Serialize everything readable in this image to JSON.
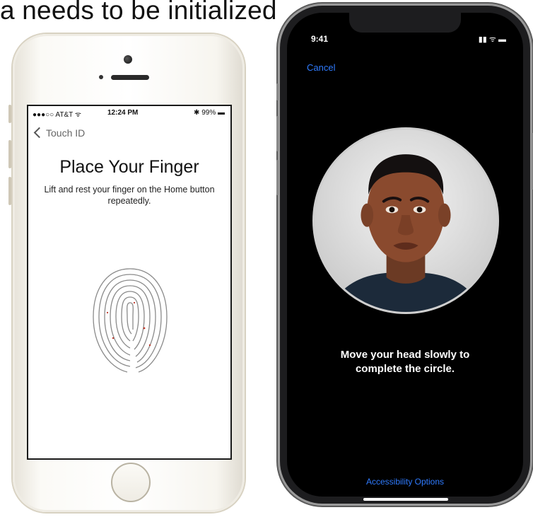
{
  "caption": "a needs to be initialized",
  "touch_id_phone": {
    "status": {
      "carrier": "●●●○○ AT&T ᯤ",
      "time": "12:24 PM",
      "battery": "✱ 99% ▬"
    },
    "nav_back": "Touch ID",
    "title": "Place Your Finger",
    "subtitle": "Lift and rest your finger on the Home button repeatedly."
  },
  "face_id_phone": {
    "status": {
      "time": "9:41",
      "icons": "▮▮ ᯤ ▬"
    },
    "cancel": "Cancel",
    "message": "Move your head slowly to complete the circle.",
    "accessibility": "Accessibility Options"
  },
  "colors": {
    "ios_blue": "#2f7bff",
    "gold_frame": "#d8d2c2"
  },
  "icons": [
    "chevron-left-icon",
    "fingerprint-icon",
    "signal-icon",
    "wifi-icon",
    "battery-icon",
    "face-icon"
  ]
}
